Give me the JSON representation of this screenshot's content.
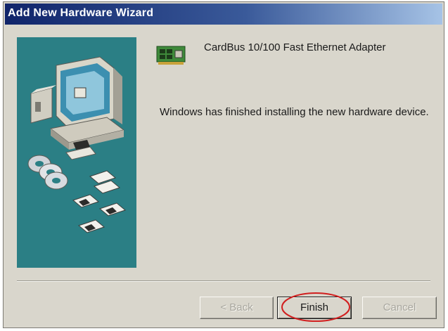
{
  "window": {
    "title": "Add New Hardware Wizard"
  },
  "device": {
    "icon": "network-card-icon",
    "name": "CardBus 10/100 Fast Ethernet Adapter"
  },
  "message": "Windows has finished installing the new hardware device.",
  "buttons": {
    "back_label": "< Back",
    "finish_label": "Finish",
    "cancel_label": "Cancel"
  },
  "colors": {
    "title_bar_start": "#10246a",
    "title_bar_end": "#a6c3e6",
    "dialog_face": "#d9d6cc",
    "side_panel": "#2b7f85",
    "annotation_circle": "#d11f1f"
  }
}
